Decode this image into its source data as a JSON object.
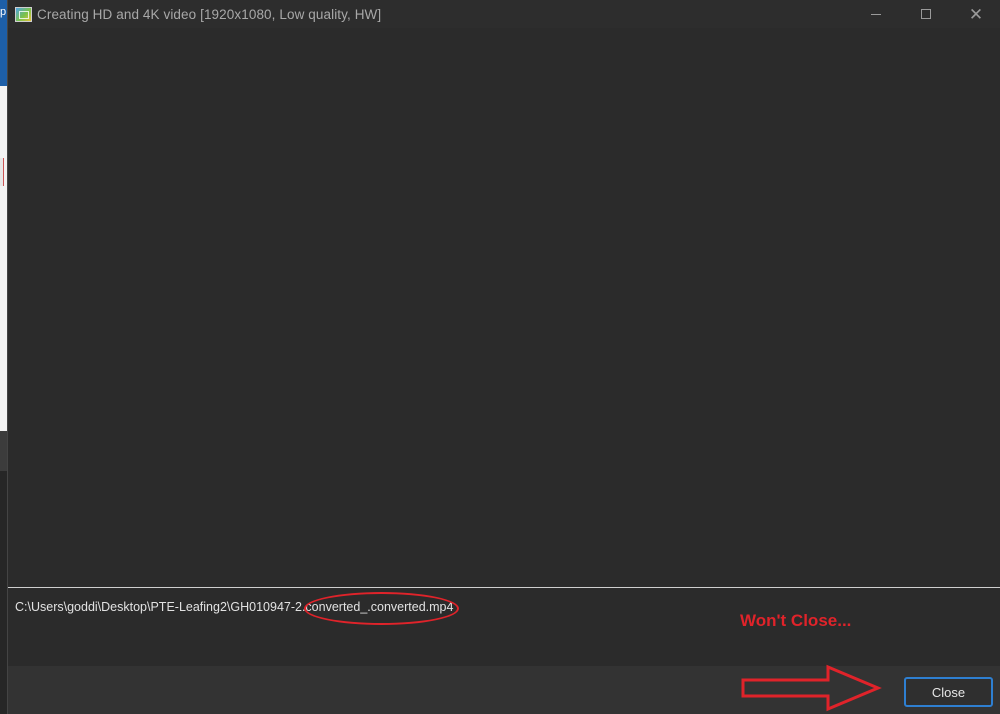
{
  "window": {
    "title": "Creating HD and 4K video [1920x1080, Low quality, HW]",
    "icon": "app-logo-icon"
  },
  "window_controls": {
    "minimize_icon": "minimize-icon",
    "maximize_icon": "maximize-icon",
    "close_icon": "close-icon",
    "close_glyph": "✕"
  },
  "status": {
    "file_path": "C:\\Users\\goddi\\Desktop\\PTE-Leafing2\\GH010947-2.converted_.converted.mp4"
  },
  "footer": {
    "close_label": "Close"
  },
  "annotation": {
    "note": "Won't Close...",
    "color": "#e0232a"
  },
  "background_app": {
    "glyph": "p"
  },
  "colors": {
    "accent": "#2e7fd1",
    "background": "#2b2b2b",
    "annotation": "#e0232a"
  }
}
